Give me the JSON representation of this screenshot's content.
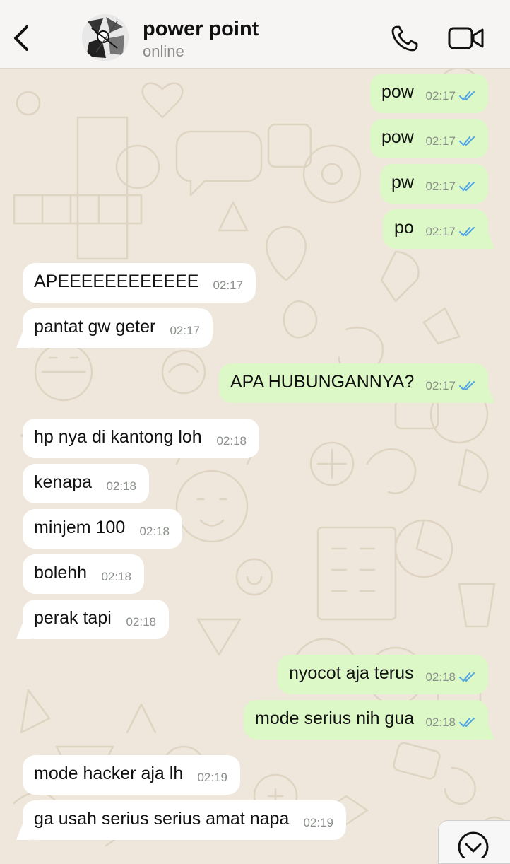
{
  "header": {
    "contact_name": "power point",
    "status": "online"
  },
  "messages": [
    {
      "dir": "out",
      "text": "pow",
      "time": "02:17"
    },
    {
      "dir": "out",
      "text": "pow",
      "time": "02:17"
    },
    {
      "dir": "out",
      "text": "pw",
      "time": "02:17"
    },
    {
      "dir": "out",
      "text": "po",
      "time": "02:17"
    },
    {
      "dir": "in",
      "text": "APEEEEEEEEEEEE",
      "time": "02:17"
    },
    {
      "dir": "in",
      "text": "pantat gw geter",
      "time": "02:17"
    },
    {
      "dir": "out",
      "text": "APA HUBUNGANNYA?",
      "time": "02:17"
    },
    {
      "dir": "in",
      "text": "hp nya di kantong loh",
      "time": "02:18"
    },
    {
      "dir": "in",
      "text": "kenapa",
      "time": "02:18"
    },
    {
      "dir": "in",
      "text": "minjem 100",
      "time": "02:18"
    },
    {
      "dir": "in",
      "text": "bolehh",
      "time": "02:18"
    },
    {
      "dir": "in",
      "text": "perak tapi",
      "time": "02:18"
    },
    {
      "dir": "out",
      "text": "nyocot aja terus",
      "time": "02:18"
    },
    {
      "dir": "out",
      "text": "mode serius nih gua",
      "time": "02:18"
    },
    {
      "dir": "in",
      "text": "mode hacker aja lh",
      "time": "02:19"
    },
    {
      "dir": "in",
      "text": "ga usah serius serius amat napa",
      "time": "02:19"
    }
  ],
  "icons": {
    "back": "chevron-left-icon",
    "call": "phone-icon",
    "video": "video-camera-icon",
    "read_receipt": "double-check-icon",
    "scroll": "chevron-down-icon"
  },
  "colors": {
    "outgoing_bubble": "#dcf8c6",
    "incoming_bubble": "#ffffff",
    "wallpaper": "#efe7dc",
    "read_ticks": "#4fa3e6"
  }
}
